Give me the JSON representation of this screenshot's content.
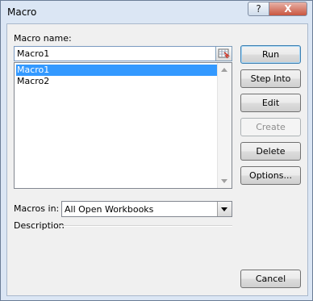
{
  "window": {
    "title": "Macro",
    "help_label": "?",
    "close_label": "X"
  },
  "macro_name": {
    "label": "Macro name:",
    "value": "Macro1",
    "ref_icon": "range-select-icon"
  },
  "macros": [
    "Macro1",
    "Macro2"
  ],
  "selected_macro": "Macro1",
  "macros_in": {
    "label": "Macros in:",
    "value": "All Open Workbooks"
  },
  "description": {
    "label": "Description"
  },
  "buttons": {
    "run": "Run",
    "step_into": "Step Into",
    "edit": "Edit",
    "create": "Create",
    "delete": "Delete",
    "options": "Options...",
    "cancel": "Cancel"
  }
}
